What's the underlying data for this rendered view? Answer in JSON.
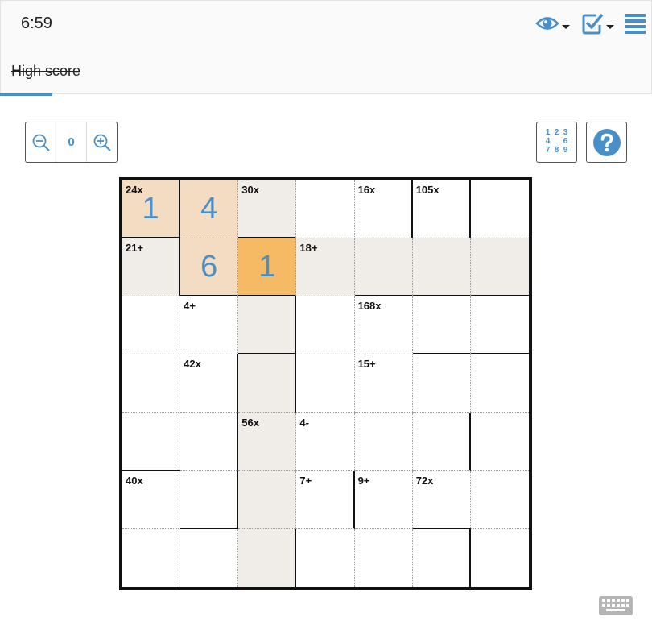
{
  "header": {
    "timer": "6:59",
    "icons": [
      "eye-icon",
      "check-icon",
      "menu-icon"
    ]
  },
  "tabs": [
    {
      "label": "High score",
      "active": true
    }
  ],
  "toolbar": {
    "zoom_value": "0",
    "pencil_digits": [
      "1",
      "2",
      "3",
      "4",
      "",
      "6",
      "7",
      "8",
      "9"
    ],
    "help_icon": "question-icon",
    "accent": "#4a90c8"
  },
  "puzzle": {
    "size": 7,
    "cells": [
      {
        "r": 0,
        "c": 0,
        "clue": "24x",
        "value": "1",
        "state": "sel2"
      },
      {
        "r": 0,
        "c": 1,
        "value": "4",
        "state": "sel2"
      },
      {
        "r": 0,
        "c": 2,
        "clue": "30x",
        "state": "hl"
      },
      {
        "r": 0,
        "c": 3
      },
      {
        "r": 0,
        "c": 4,
        "clue": "16x"
      },
      {
        "r": 0,
        "c": 5,
        "clue": "105x"
      },
      {
        "r": 0,
        "c": 6
      },
      {
        "r": 1,
        "c": 0,
        "clue": "21+",
        "state": "hl"
      },
      {
        "r": 1,
        "c": 1,
        "value": "6",
        "state": "sel2"
      },
      {
        "r": 1,
        "c": 2,
        "value": "1",
        "state": "sel"
      },
      {
        "r": 1,
        "c": 3,
        "clue": "18+",
        "state": "hl"
      },
      {
        "r": 1,
        "c": 4,
        "state": "hl"
      },
      {
        "r": 1,
        "c": 5,
        "state": "hl"
      },
      {
        "r": 1,
        "c": 6,
        "state": "hl"
      },
      {
        "r": 2,
        "c": 0
      },
      {
        "r": 2,
        "c": 1,
        "clue": "4+"
      },
      {
        "r": 2,
        "c": 2,
        "state": "hl"
      },
      {
        "r": 2,
        "c": 3
      },
      {
        "r": 2,
        "c": 4,
        "clue": "168x"
      },
      {
        "r": 2,
        "c": 5
      },
      {
        "r": 2,
        "c": 6
      },
      {
        "r": 3,
        "c": 0
      },
      {
        "r": 3,
        "c": 1,
        "clue": "42x"
      },
      {
        "r": 3,
        "c": 2,
        "state": "hl"
      },
      {
        "r": 3,
        "c": 3
      },
      {
        "r": 3,
        "c": 4,
        "clue": "15+"
      },
      {
        "r": 3,
        "c": 5
      },
      {
        "r": 3,
        "c": 6
      },
      {
        "r": 4,
        "c": 0
      },
      {
        "r": 4,
        "c": 1
      },
      {
        "r": 4,
        "c": 2,
        "clue": "56x",
        "state": "hl"
      },
      {
        "r": 4,
        "c": 3,
        "clue": "4-"
      },
      {
        "r": 4,
        "c": 4
      },
      {
        "r": 4,
        "c": 5
      },
      {
        "r": 4,
        "c": 6
      },
      {
        "r": 5,
        "c": 0,
        "clue": "40x"
      },
      {
        "r": 5,
        "c": 1
      },
      {
        "r": 5,
        "c": 2,
        "state": "hl"
      },
      {
        "r": 5,
        "c": 3,
        "clue": "7+"
      },
      {
        "r": 5,
        "c": 4,
        "clue": "9+"
      },
      {
        "r": 5,
        "c": 5,
        "clue": "72x"
      },
      {
        "r": 5,
        "c": 6
      },
      {
        "r": 6,
        "c": 0
      },
      {
        "r": 6,
        "c": 1
      },
      {
        "r": 6,
        "c": 2,
        "state": "hl"
      },
      {
        "r": 6,
        "c": 3
      },
      {
        "r": 6,
        "c": 4
      },
      {
        "r": 6,
        "c": 5
      },
      {
        "r": 6,
        "c": 6
      }
    ],
    "cage_right_borders": [
      [
        1,
        0,
        0,
        0,
        1,
        1,
        0
      ],
      [
        1,
        0,
        0,
        0,
        0,
        0,
        0
      ],
      [
        0,
        0,
        1,
        0,
        0,
        0,
        0
      ],
      [
        0,
        1,
        1,
        0,
        0,
        0,
        0
      ],
      [
        0,
        1,
        0,
        0,
        0,
        1,
        0
      ],
      [
        0,
        1,
        0,
        1,
        0,
        0,
        0
      ],
      [
        0,
        0,
        1,
        0,
        0,
        1,
        0
      ]
    ],
    "cage_bottom_borders": [
      [
        1,
        0,
        1,
        0,
        0,
        0,
        0
      ],
      [
        0,
        1,
        1,
        0,
        1,
        1,
        1
      ],
      [
        0,
        0,
        1,
        0,
        0,
        1,
        1
      ],
      [
        0,
        0,
        0,
        0,
        0,
        0,
        0
      ],
      [
        1,
        0,
        0,
        0,
        0,
        0,
        0
      ],
      [
        0,
        1,
        0,
        0,
        0,
        1,
        0
      ],
      [
        0,
        0,
        0,
        0,
        0,
        0,
        0
      ]
    ],
    "colors": {
      "highlight": "#f0ece8",
      "selected": "#f6b964",
      "cage_selected": "#f3dcc2",
      "value": "#4a8fc6"
    }
  },
  "footer": {
    "keyboard_icon": "keyboard-icon"
  }
}
